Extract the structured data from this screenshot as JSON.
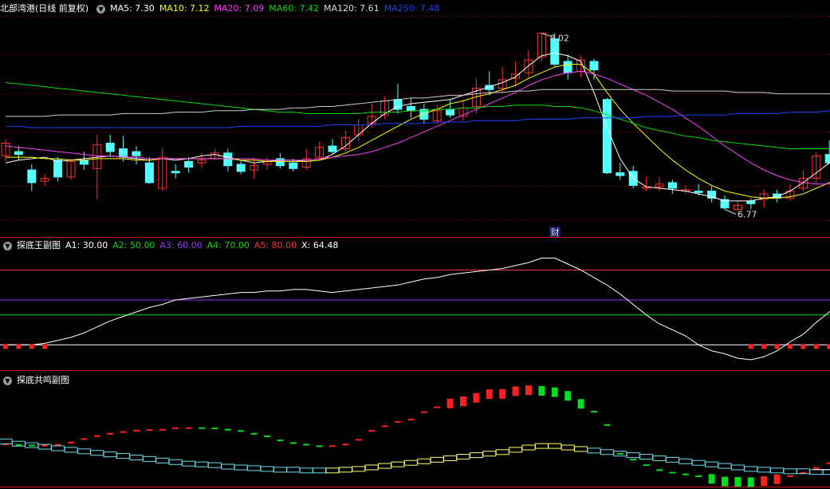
{
  "main_panel": {
    "title": "北部湾港(日线 前复权)",
    "indicators": [
      {
        "label": "MA5: 7.30",
        "color": "#ffffff"
      },
      {
        "label": "MA10: 7.12",
        "color": "#ffff00"
      },
      {
        "label": "MA20: 7.09",
        "color": "#ff3cff"
      },
      {
        "label": "MA60: 7.42",
        "color": "#00dd00"
      },
      {
        "label": "MA120: 7.61",
        "color": "#dddddd"
      },
      {
        "label": "MA250: 7.48",
        "color": "#2040ff"
      }
    ],
    "high_label": "8.02",
    "low_label": "6.77",
    "event_label": "财"
  },
  "sub_panel_1": {
    "title": "探底王副图",
    "indicators": [
      {
        "label": "A1: 30.00",
        "color": "#ffffff"
      },
      {
        "label": "A2: 50.00",
        "color": "#00dd00"
      },
      {
        "label": "A3: 60.00",
        "color": "#9933ff"
      },
      {
        "label": "A4: 70.00",
        "color": "#00dd00"
      },
      {
        "label": "A5: 80.00",
        "color": "#ff3333"
      },
      {
        "label": "X: 64.48",
        "color": "#ffffff"
      }
    ]
  },
  "sub_panel_2": {
    "title": "探底共鸣副图"
  },
  "chart_data": {
    "type": "candlestick",
    "up_color": "#ff3030",
    "down_color": "#54ffff",
    "price_range": [
      6.62,
      8.12
    ],
    "candles": [
      [
        7.15,
        7.24,
        7.27,
        7.11
      ],
      [
        7.18,
        7.16,
        7.22,
        7.12
      ],
      [
        7.05,
        6.96,
        7.09,
        6.9
      ],
      [
        6.97,
        6.99,
        7.02,
        6.94
      ],
      [
        7.12,
        7.0,
        7.14,
        6.97
      ],
      [
        7.0,
        7.11,
        7.13,
        6.98
      ],
      [
        7.12,
        7.09,
        7.18,
        7.05
      ],
      [
        7.06,
        7.23,
        7.3,
        6.84
      ],
      [
        7.24,
        7.18,
        7.3,
        7.14
      ],
      [
        7.2,
        7.14,
        7.29,
        7.11
      ],
      [
        7.18,
        7.15,
        7.22,
        7.09
      ],
      [
        7.1,
        6.96,
        7.14,
        6.95
      ],
      [
        6.92,
        7.14,
        7.2,
        6.9
      ],
      [
        7.04,
        7.03,
        7.09,
        6.99
      ],
      [
        7.11,
        7.07,
        7.14,
        7.03
      ],
      [
        7.1,
        7.12,
        7.17,
        7.06
      ],
      [
        7.13,
        7.17,
        7.2,
        7.12
      ],
      [
        7.17,
        7.08,
        7.2,
        7.04
      ],
      [
        7.09,
        7.04,
        7.12,
        7.02
      ],
      [
        7.05,
        7.08,
        7.13,
        6.99
      ],
      [
        7.09,
        7.11,
        7.14,
        7.05
      ],
      [
        7.13,
        7.08,
        7.17,
        7.06
      ],
      [
        7.1,
        7.06,
        7.13,
        7.04
      ],
      [
        7.07,
        7.13,
        7.2,
        7.05
      ],
      [
        7.14,
        7.21,
        7.25,
        7.13
      ],
      [
        7.22,
        7.18,
        7.27,
        7.16
      ],
      [
        7.2,
        7.28,
        7.33,
        7.18
      ],
      [
        7.3,
        7.37,
        7.41,
        7.26
      ],
      [
        7.38,
        7.43,
        7.52,
        7.35
      ],
      [
        7.44,
        7.54,
        7.57,
        7.41
      ],
      [
        7.55,
        7.48,
        7.66,
        7.45
      ],
      [
        7.5,
        7.47,
        7.56,
        7.42
      ],
      [
        7.48,
        7.41,
        7.52,
        7.38
      ],
      [
        7.4,
        7.47,
        7.51,
        7.38
      ],
      [
        7.48,
        7.44,
        7.55,
        7.42
      ],
      [
        7.43,
        7.49,
        7.55,
        7.4
      ],
      [
        7.5,
        7.63,
        7.7,
        7.45
      ],
      [
        7.65,
        7.62,
        7.75,
        7.58
      ],
      [
        7.63,
        7.69,
        7.78,
        7.6
      ],
      [
        7.7,
        7.73,
        7.82,
        7.65
      ],
      [
        7.74,
        7.83,
        7.9,
        7.7
      ],
      [
        7.85,
        8.02,
        8.02,
        7.82
      ],
      [
        7.98,
        7.8,
        8.02,
        7.78
      ],
      [
        7.82,
        7.74,
        7.87,
        7.69
      ],
      [
        7.75,
        7.83,
        7.86,
        7.71
      ],
      [
        7.82,
        7.76,
        7.84,
        7.69
      ],
      [
        7.55,
        7.03,
        7.56,
        7.02
      ],
      [
        7.03,
        7.01,
        7.1,
        6.98
      ],
      [
        7.04,
        6.94,
        7.08,
        6.92
      ],
      [
        6.92,
        6.93,
        7.0,
        6.9
      ],
      [
        6.93,
        6.95,
        7.0,
        6.9
      ],
      [
        6.96,
        6.92,
        6.98,
        6.88
      ],
      [
        6.9,
        6.91,
        6.94,
        6.88
      ],
      [
        6.9,
        6.89,
        6.95,
        6.87
      ],
      [
        6.9,
        6.85,
        6.93,
        6.82
      ],
      [
        6.84,
        6.78,
        6.87,
        6.77
      ],
      [
        6.77,
        6.8,
        6.83,
        6.75
      ],
      [
        6.83,
        6.81,
        6.85,
        6.77
      ],
      [
        6.84,
        6.88,
        6.91,
        6.78
      ],
      [
        6.88,
        6.85,
        6.91,
        6.82
      ],
      [
        6.85,
        6.9,
        6.95,
        6.83
      ],
      [
        6.92,
        6.99,
        7.05,
        6.9
      ],
      [
        6.99,
        7.15,
        7.18,
        6.95
      ],
      [
        7.16,
        7.1,
        7.26,
        7.1
      ],
      [
        7.15,
        7.25,
        7.28,
        7.12
      ],
      [
        7.18,
        7.45,
        7.46,
        7.1
      ]
    ],
    "ma_lines": {
      "MA5": [
        7.1,
        7.12,
        7.13,
        7.14,
        7.11,
        7.12,
        7.13,
        7.14,
        7.15,
        7.14,
        7.13,
        7.12,
        7.13,
        7.12,
        7.13,
        7.15,
        7.16,
        7.14,
        7.12,
        7.1,
        7.11,
        7.12,
        7.12,
        7.11,
        7.12,
        7.16,
        7.22,
        7.3,
        7.38,
        7.45,
        7.5,
        7.52,
        7.53,
        7.54,
        7.55,
        7.58,
        7.61,
        7.64,
        7.67,
        7.71,
        7.79,
        7.86,
        7.88,
        7.86,
        7.82,
        7.6,
        7.35,
        7.13,
        6.99,
        6.93,
        6.92,
        6.91,
        6.9,
        6.88,
        6.86,
        6.83,
        6.83,
        6.83,
        6.85,
        6.86,
        6.9,
        6.96,
        7.03,
        7.1,
        7.16,
        7.33
      ],
      "MA10": [
        7.14,
        7.14,
        7.14,
        7.13,
        7.13,
        7.12,
        7.12,
        7.13,
        7.13,
        7.13,
        7.12,
        7.12,
        7.13,
        7.13,
        7.13,
        7.13,
        7.13,
        7.13,
        7.12,
        7.12,
        7.11,
        7.11,
        7.11,
        7.11,
        7.12,
        7.14,
        7.17,
        7.21,
        7.26,
        7.31,
        7.36,
        7.41,
        7.45,
        7.48,
        7.52,
        7.54,
        7.57,
        7.59,
        7.62,
        7.65,
        7.7,
        7.74,
        7.78,
        7.8,
        7.8,
        7.73,
        7.6,
        7.48,
        7.38,
        7.29,
        7.2,
        7.12,
        7.05,
        6.99,
        6.94,
        6.9,
        6.88,
        6.86,
        6.85,
        6.85,
        6.86,
        6.88,
        6.92,
        6.96,
        7.02,
        7.12
      ],
      "MA20": [
        7.22,
        7.21,
        7.2,
        7.19,
        7.18,
        7.17,
        7.16,
        7.15,
        7.15,
        7.14,
        7.14,
        7.13,
        7.13,
        7.13,
        7.13,
        7.13,
        7.13,
        7.13,
        7.13,
        7.13,
        7.12,
        7.12,
        7.12,
        7.12,
        7.13,
        7.14,
        7.15,
        7.16,
        7.18,
        7.21,
        7.24,
        7.28,
        7.32,
        7.36,
        7.4,
        7.44,
        7.48,
        7.52,
        7.56,
        7.6,
        7.65,
        7.69,
        7.72,
        7.74,
        7.75,
        7.73,
        7.7,
        7.66,
        7.62,
        7.58,
        7.53,
        7.48,
        7.42,
        7.36,
        7.29,
        7.22,
        7.16,
        7.1,
        7.05,
        7.01,
        6.98,
        6.96,
        6.95,
        6.95,
        6.96,
        6.98
      ],
      "MA60": [
        7.67,
        7.66,
        7.65,
        7.64,
        7.63,
        7.62,
        7.61,
        7.6,
        7.59,
        7.58,
        7.57,
        7.56,
        7.55,
        7.54,
        7.53,
        7.52,
        7.51,
        7.5,
        7.49,
        7.48,
        7.47,
        7.46,
        7.46,
        7.45,
        7.45,
        7.45,
        7.45,
        7.45,
        7.46,
        7.46,
        7.46,
        7.47,
        7.47,
        7.48,
        7.48,
        7.49,
        7.49,
        7.5,
        7.5,
        7.51,
        7.51,
        7.51,
        7.5,
        7.5,
        7.49,
        7.47,
        7.44,
        7.41,
        7.38,
        7.35,
        7.33,
        7.31,
        7.29,
        7.28,
        7.26,
        7.25,
        7.24,
        7.23,
        7.22,
        7.21,
        7.2,
        7.2,
        7.2,
        7.2,
        7.21,
        7.22
      ],
      "MA120": [
        7.43,
        7.43,
        7.43,
        7.43,
        7.44,
        7.44,
        7.44,
        7.44,
        7.44,
        7.45,
        7.45,
        7.45,
        7.45,
        7.46,
        7.46,
        7.46,
        7.47,
        7.47,
        7.47,
        7.48,
        7.48,
        7.48,
        7.49,
        7.49,
        7.5,
        7.5,
        7.51,
        7.52,
        7.53,
        7.54,
        7.55,
        7.56,
        7.56,
        7.57,
        7.58,
        7.58,
        7.59,
        7.6,
        7.6,
        7.61,
        7.61,
        7.62,
        7.62,
        7.62,
        7.62,
        7.62,
        7.62,
        7.62,
        7.62,
        7.62,
        7.62,
        7.61,
        7.61,
        7.61,
        7.61,
        7.61,
        7.6,
        7.6,
        7.6,
        7.59,
        7.59,
        7.59,
        7.59,
        7.59,
        7.59,
        7.59
      ],
      "MA250": [
        7.36,
        7.36,
        7.35,
        7.35,
        7.35,
        7.35,
        7.35,
        7.35,
        7.35,
        7.35,
        7.35,
        7.35,
        7.35,
        7.35,
        7.35,
        7.35,
        7.35,
        7.35,
        7.36,
        7.36,
        7.36,
        7.36,
        7.36,
        7.36,
        7.36,
        7.37,
        7.37,
        7.37,
        7.37,
        7.38,
        7.38,
        7.38,
        7.38,
        7.39,
        7.39,
        7.39,
        7.4,
        7.4,
        7.4,
        7.4,
        7.41,
        7.41,
        7.41,
        7.41,
        7.42,
        7.42,
        7.42,
        7.42,
        7.42,
        7.43,
        7.43,
        7.43,
        7.44,
        7.44,
        7.44,
        7.44,
        7.45,
        7.45,
        7.45,
        7.45,
        7.46,
        7.46,
        7.46,
        7.47,
        7.47,
        7.48
      ]
    },
    "sub1": {
      "range": [
        12,
        92
      ],
      "ref_lines": [
        {
          "name": "A1",
          "value": 30,
          "color": "#ffffff"
        },
        {
          "name": "A2",
          "value": 50,
          "color": "#00dd00"
        },
        {
          "name": "A3",
          "value": 60,
          "color": "#9933ff"
        },
        {
          "name": "A5",
          "value": 80,
          "color": "#ff3333"
        }
      ],
      "x_line": [
        30,
        30,
        30,
        31,
        33,
        35,
        38,
        42,
        46,
        49,
        52,
        55,
        57,
        60,
        61,
        62,
        63,
        64,
        65,
        65,
        66,
        66,
        67,
        67,
        66,
        65,
        66,
        67,
        68,
        69,
        70,
        72,
        74,
        75,
        77,
        78,
        79,
        80,
        81,
        83,
        85,
        88,
        88,
        84,
        80,
        75,
        70,
        64,
        57,
        50,
        44,
        40,
        36,
        30,
        26,
        24,
        21,
        20,
        22,
        26,
        32,
        37,
        45,
        52,
        57,
        62
      ],
      "signal_marks": [
        0,
        1,
        2,
        3,
        57,
        58,
        59,
        60,
        61,
        62,
        63,
        64,
        65,
        66
      ]
    },
    "sub2": {
      "range": [
        -10,
        115
      ],
      "outer": [
        -5.8,
        -7,
        -8.4,
        -8.4,
        -6.9,
        -1.6,
        6.3,
        13,
        18.4,
        22.4,
        25.3,
        26.7,
        27.7,
        31.2,
        31.3,
        31.2,
        30.5,
        27.7,
        24.8,
        18.3,
        12.7,
        3.3,
        -2.9,
        -6.4,
        -10.2,
        -9.8,
        -6,
        4.5,
        25.2,
        35.6,
        45.6,
        50.9,
        67.7,
        78.7,
        87.7,
        92.5,
        100.5,
        108.9,
        109.5,
        115.6,
        118,
        116.4,
        113.3,
        105.1,
        86.7,
        68.8,
        38.4,
        -27.4,
        -40.6,
        -53.3,
        -64.7,
        -70.5,
        -74.3,
        -78.6,
        -84.6,
        -90.6,
        -91.3,
        -92,
        -89.8,
        -85.5,
        -78.3,
        -70.8,
        -60,
        -49,
        -29.5,
        -15.6
      ],
      "inner": [
        48,
        45,
        43,
        41,
        39,
        37,
        35,
        33,
        31,
        29,
        27,
        25,
        23,
        21,
        19,
        18,
        17,
        15,
        14,
        13,
        12,
        11,
        11,
        10,
        10,
        10,
        11,
        12,
        14,
        16,
        18,
        20,
        22,
        24,
        26,
        28,
        30,
        32,
        34,
        37,
        40,
        42,
        42,
        40,
        38,
        36,
        34,
        32,
        30,
        28,
        26,
        24,
        22,
        20,
        18,
        16,
        14,
        12,
        11,
        10,
        9,
        9,
        8,
        8,
        9,
        9
      ]
    }
  }
}
